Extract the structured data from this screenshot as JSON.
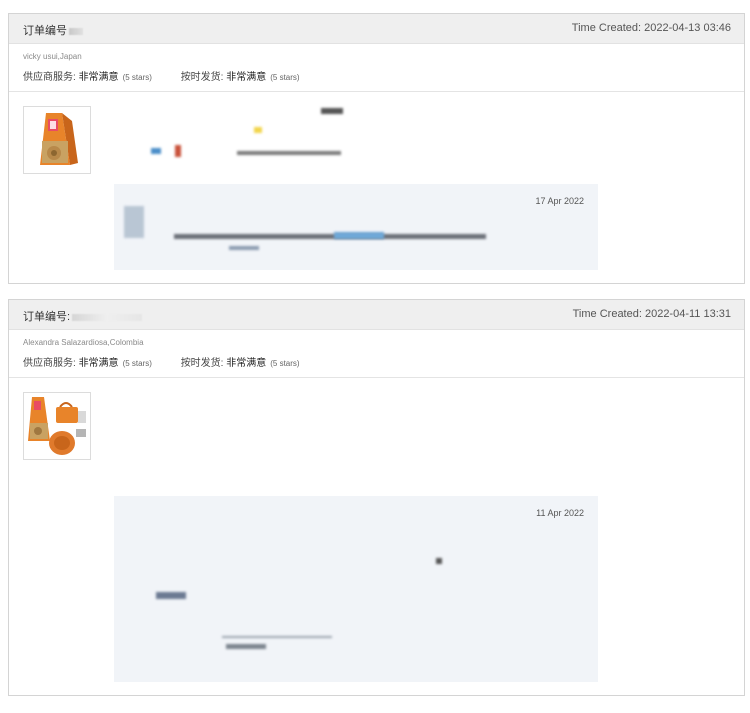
{
  "orders": [
    {
      "order_label": "订单编号",
      "time_created": "Time Created: 2022-04-13 03:46",
      "buyer": "vicky usui,Japan",
      "ratings": [
        {
          "label": "供应商服务:",
          "value": "非常满意",
          "stars": "(5 stars)"
        },
        {
          "label": "按时发货:",
          "value": "非常满意",
          "stars": "(5 stars)"
        }
      ],
      "product_icon": "orange-cat-scratcher-thumbnail",
      "feedback_date": "17 Apr 2022"
    },
    {
      "order_label": "订单编号:",
      "time_created": "Time Created: 2022-04-11 13:31",
      "buyer": "Alexandra Salazardiosa,Colombia",
      "ratings": [
        {
          "label": "供应商服务:",
          "value": "非常满意",
          "stars": "(5 stars)"
        },
        {
          "label": "按时发货:",
          "value": "非常满意",
          "stars": "(5 stars)"
        }
      ],
      "product_icon": "orange-cat-scratcher-bundle-thumbnail",
      "feedback_date": "11 Apr 2022"
    }
  ],
  "colors": {
    "header_bg": "#efefef",
    "border": "#d4d4d4",
    "feedback_bg": "#f1f4f8",
    "product_orange": "#e8842a"
  }
}
